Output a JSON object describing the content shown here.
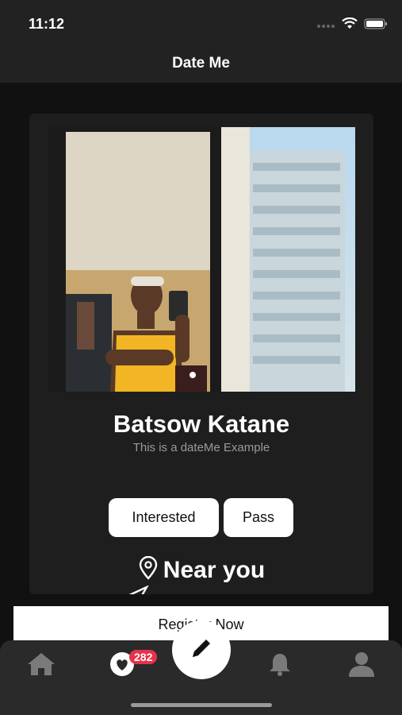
{
  "status": {
    "time": "11:12"
  },
  "nav": {
    "title": "Date Me"
  },
  "profile": {
    "name": "Batsow Katane",
    "subtitle": "This is a dateMe Example",
    "interested_label": "Interested",
    "pass_label": "Pass",
    "location_label": "Near you"
  },
  "register": {
    "label": "Register Now"
  },
  "tabs": {
    "badge_count": "282",
    "items": [
      "home-icon",
      "heart-icon",
      "pencil-icon",
      "bell-icon",
      "user-icon"
    ]
  },
  "colors": {
    "background": "#111111",
    "card": "#1e1e1e",
    "tab_bar": "#2a2a2a",
    "badge": "#e8324a",
    "button": "#ffffff"
  }
}
